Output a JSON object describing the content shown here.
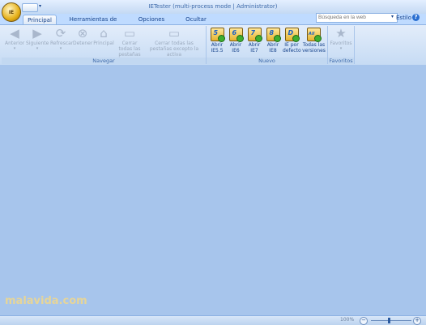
{
  "window": {
    "title": "IETester (multi-process mode | Administrator)"
  },
  "app": {
    "orb_label": "IE"
  },
  "tabs": [
    {
      "label": "Principal",
      "active": true
    },
    {
      "label": "Herramientas de desarrollo",
      "active": false
    },
    {
      "label": "Opciones",
      "active": false
    },
    {
      "label": "Ocultar botones",
      "active": false
    }
  ],
  "search": {
    "placeholder": "Búsqueda en la web"
  },
  "style_menu": {
    "label": "Estilo"
  },
  "ribbon": {
    "navegar": {
      "label": "Navegar",
      "buttons": [
        {
          "label": "Anterior",
          "icon": "back-arrow-icon"
        },
        {
          "label": "Siguiente",
          "icon": "forward-arrow-icon"
        },
        {
          "label": "Refrescar",
          "icon": "refresh-icon"
        },
        {
          "label": "Detener",
          "icon": "stop-icon"
        },
        {
          "label": "Principal",
          "icon": "home-icon"
        },
        {
          "label": "Cerrar todas las pestañas",
          "icon": "close-tabs-icon"
        },
        {
          "label": "Cerrar todas las pestañas excepto la activa",
          "icon": "close-other-tabs-icon"
        }
      ]
    },
    "nuevo": {
      "label": "Nuevo",
      "buttons": [
        {
          "label": "Abrir IE5.5",
          "icon": "ie-icon",
          "badge": "5"
        },
        {
          "label": "Abrir IE6",
          "icon": "ie-icon",
          "badge": "6"
        },
        {
          "label": "Abrir IE7",
          "icon": "ie-icon",
          "badge": "7"
        },
        {
          "label": "Abrir IE8",
          "icon": "ie-icon",
          "badge": "8"
        },
        {
          "label": "IE por defecto",
          "icon": "ie-icon",
          "badge": "D"
        },
        {
          "label": "Todas las versiones",
          "icon": "ie-icon",
          "badge": "All"
        }
      ]
    },
    "favoritos": {
      "label": "Favoritos",
      "buttons": [
        {
          "label": "Favoritos",
          "icon": "star-icon"
        }
      ]
    }
  },
  "watermark": {
    "text": "malavida.com"
  },
  "status": {
    "zoom": "100%"
  },
  "colors": {
    "ribbon_text": "#15428b",
    "content_bg": "#a7c5ec"
  }
}
